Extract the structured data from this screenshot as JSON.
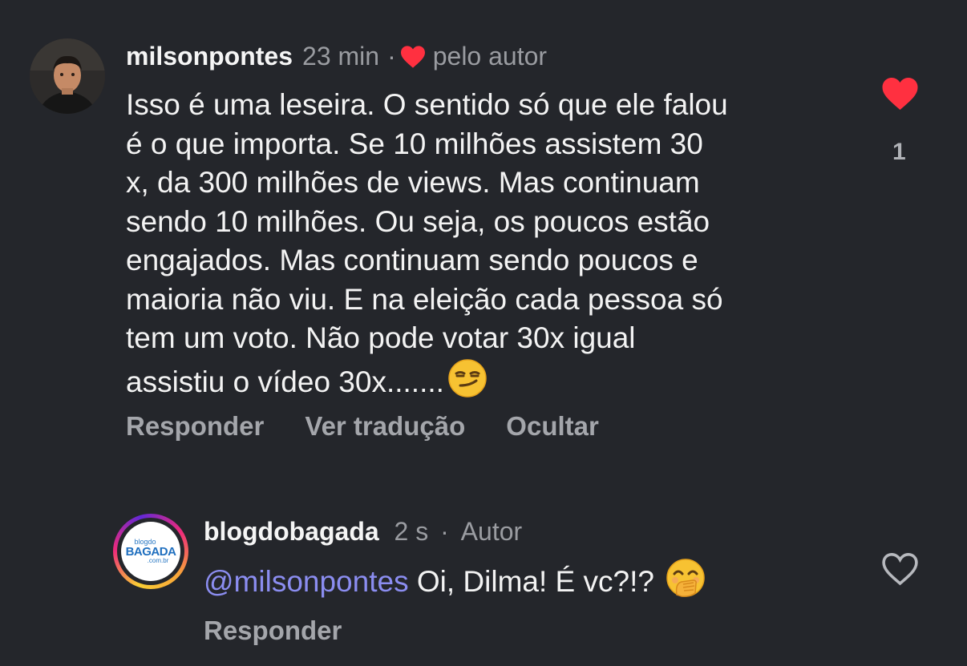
{
  "comment": {
    "username": "milsonpontes",
    "time": "23 min",
    "separator": "·",
    "liked_by_author": "pelo autor",
    "text": "Isso é uma leseira. O sentido só que ele falou\né o que importa. Se 10 milhões assistem 30\nx, da 300 milhões de views. Mas continuam\nsendo 10 milhões. Ou seja, os poucos estão\nengajados. Mas continuam sendo poucos e\nmaioria não viu. E na eleição cada pessoa só\ntem um voto. Não pode votar 30x igual\nassistiu o vídeo 30x.......",
    "emoji": "smirking-face-emoji",
    "actions": {
      "reply": "Responder",
      "translate": "Ver tradução",
      "hide": "Ocultar"
    },
    "like_count": "1",
    "like_color": "#ff3040"
  },
  "reply": {
    "username": "blogdobagada",
    "time": "2 s",
    "separator": "·",
    "badge": "Autor",
    "mention": "@milsonpontes",
    "text": " Oi, Dilma! É vc?!? ",
    "emoji": "face-with-hand-over-mouth-emoji",
    "avatar_logo": {
      "small": "blogdo",
      "big": "BAGADA",
      "domain": ".com.br"
    },
    "actions": {
      "reply": "Responder"
    }
  },
  "colors": {
    "background": "#24262b",
    "mention": "#8b8df0",
    "muted": "#9a9ca1"
  }
}
